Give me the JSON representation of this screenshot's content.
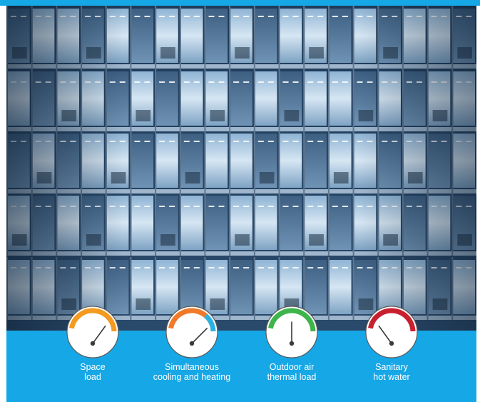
{
  "gauges": [
    {
      "id": "space-load",
      "line1": "Space",
      "line2": "load",
      "level": 0.7,
      "arc_color": "#f39a1f",
      "arc_color_2": ""
    },
    {
      "id": "simultaneous-cooling-heating",
      "line1": "Simultaneous",
      "line2": "cooling and heating",
      "level": 0.75,
      "arc_color": "#f07a2a",
      "arc_color_2": "#2bb1e0"
    },
    {
      "id": "outdoor-air-thermal-load",
      "line1": "Outdoor air",
      "line2": "thermal load",
      "level": 0.5,
      "arc_color": "#3db54a",
      "arc_color_2": ""
    },
    {
      "id": "sanitary-hot-water",
      "line1": "Sanitary",
      "line2": "hot water",
      "level": 0.3,
      "arc_color": "#c8202f",
      "arc_color_2": ""
    }
  ],
  "colors": {
    "background": "#16a7e6",
    "text": "#ffffff"
  },
  "photo": {
    "subject": "glass office building facade"
  }
}
